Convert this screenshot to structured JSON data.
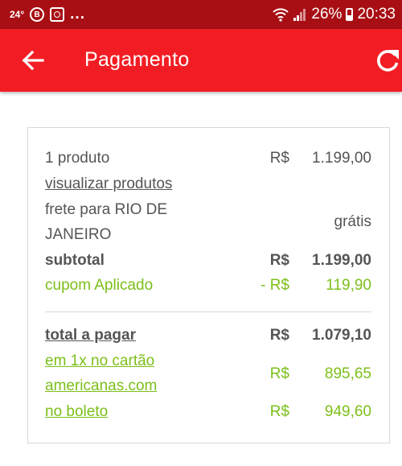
{
  "status_bar": {
    "temperature": "24°",
    "circle_glyph": "B",
    "more": "...",
    "battery": "26%",
    "time": "20:33",
    "icons": [
      "wifi-icon",
      "signal-icon",
      "battery-icon"
    ]
  },
  "app_bar": {
    "title": "Pagamento",
    "back_icon": "arrow-left-icon",
    "refresh_icon": "refresh-icon",
    "color": "#f21d24"
  },
  "summary": {
    "products": {
      "label": "1 produto",
      "currency": "R$",
      "value": "1.199,00"
    },
    "view_products": "visualizar produtos",
    "shipping": {
      "line1": "frete para RIO DE",
      "line2": "JANEIRO",
      "value": "grátis"
    },
    "subtotal": {
      "label": "subtotal",
      "currency": "R$",
      "value": "1.199,00"
    },
    "coupon": {
      "label": "cupom Aplicado",
      "currency": "- R$",
      "value": "119,90"
    },
    "total": {
      "label": "total a pagar",
      "currency": "R$",
      "value": "1.079,10"
    },
    "card_option": {
      "line1": "em 1x no cartão",
      "line2": "americanas.com",
      "currency": "R$",
      "value": "895,65"
    },
    "boleto_option": {
      "label": "no boleto",
      "currency": "R$",
      "value": "949,60"
    }
  },
  "colors": {
    "status_bar": "#a80f14",
    "accent_green": "#7cbf1a",
    "text": "#555555"
  }
}
